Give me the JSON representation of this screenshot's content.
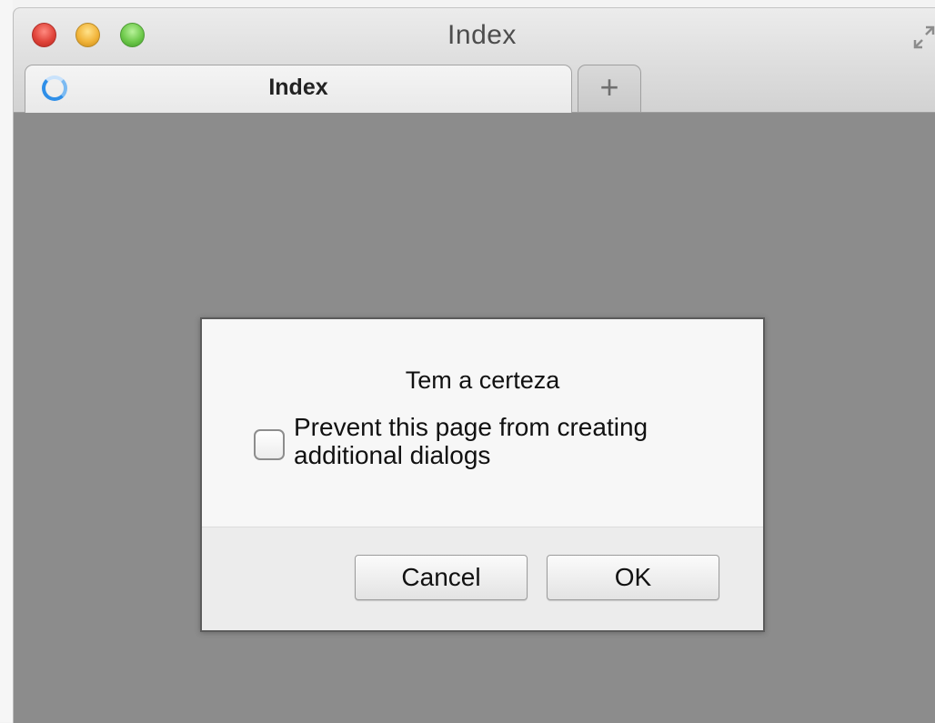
{
  "window": {
    "title": "Index"
  },
  "tabs": {
    "active_label": "Index",
    "new_tab_label": "+"
  },
  "dialog": {
    "message": "Tem a certeza",
    "checkbox_label": "Prevent this page from creating additional dialogs",
    "checkbox_checked": false,
    "cancel_label": "Cancel",
    "ok_label": "OK"
  },
  "icons": {
    "fullscreen": "fullscreen-icon",
    "loading": "loading-spinner-icon"
  },
  "colors": {
    "close": "#e0443a",
    "minimize": "#f1b43a",
    "zoom": "#6ec94b",
    "spinner": "#2f8fe8",
    "backdrop": "#8c8c8c"
  }
}
